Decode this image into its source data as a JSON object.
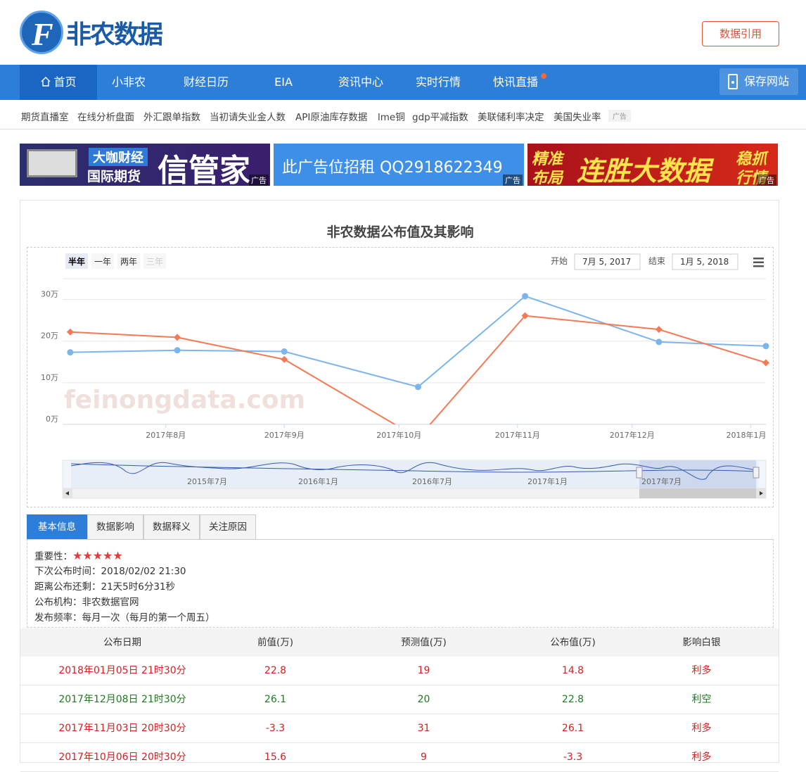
{
  "brand": {
    "name": "非农数据",
    "logo_letter": "F"
  },
  "header": {
    "cite_button": "数据引用"
  },
  "nav": {
    "items": [
      {
        "label": "首页",
        "active": true
      },
      {
        "label": "小非农"
      },
      {
        "label": "财经日历"
      },
      {
        "label": "EIA"
      },
      {
        "label": "资讯中心"
      },
      {
        "label": "实时行情"
      },
      {
        "label": "快讯直播",
        "dot": true
      }
    ],
    "save_button": "保存网站"
  },
  "quicklinks": {
    "items": [
      "期货直播室",
      "在线分析盘面",
      "外汇跟单指数",
      "当初请失业金人数",
      "API原油库存数据",
      "lme铜",
      "gdp平减指数",
      "美联储利率决定",
      "美国失业率"
    ],
    "ad_tag": "广告"
  },
  "ads": [
    {
      "text_top": "大咖财经",
      "text_bottom": "国际期货",
      "text_big": "信管家",
      "label": "广告"
    },
    {
      "text": "此广告位招租 QQ2918622349",
      "label": "广告"
    },
    {
      "text_left_top": "精准",
      "text_left_bottom": "布局",
      "text_big": "连胜大数据",
      "text_right_top": "稳抓",
      "text_right_bottom": "行情",
      "label": "广告"
    }
  ],
  "chart": {
    "title": "非农数据公布值及其影响",
    "range_buttons": [
      "半年",
      "一年",
      "两年",
      "三年"
    ],
    "active_range": "半年",
    "start_label": "开始",
    "start_value": "7月 5, 2017",
    "end_label": "结束",
    "end_value": "1月 5, 2018",
    "watermark": "feinongdata.com",
    "navigator_labels": [
      "2015年7月",
      "2016年1月",
      "2016年7月",
      "2017年1月",
      "2017年7月"
    ]
  },
  "chart_data": {
    "type": "line",
    "x": [
      "2017-07-07",
      "2017-08-04",
      "2017-09-01",
      "2017-10-06",
      "2017-11-03",
      "2017-12-08",
      "2018-01-05"
    ],
    "x_tick_labels": [
      "2017年8月",
      "2017年9月",
      "2017年10月",
      "2017年11月",
      "2017年12月",
      "2018年1月"
    ],
    "y_tick_labels": [
      "0万",
      "10万",
      "20万",
      "30万"
    ],
    "ylim": [
      0,
      30
    ],
    "grid": true,
    "colors": {
      "blue": "#7cb5ec",
      "orange": "#f47a55"
    },
    "series": [
      {
        "color": "#7cb5ec",
        "marker": "circle",
        "values": [
          17.3,
          17.8,
          17.5,
          9.0,
          30.8,
          19.8,
          18.8
        ]
      },
      {
        "color": "#f47a55",
        "marker": "diamond",
        "values": [
          22.2,
          20.9,
          15.6,
          -3.3,
          26.1,
          22.8,
          14.8
        ]
      }
    ]
  },
  "info": {
    "tabs": [
      "基本信息",
      "数据影响",
      "数据释义",
      "关注原因"
    ],
    "importance_label": "重要性：",
    "stars": 5,
    "next_release": "下次公布时间：2018/02/02 21:30",
    "countdown": "距离公布还剩：21天5时6分31秒",
    "agency": "公布机构：非农数据官网",
    "frequency": "发布频率：每月一次（每月的第一个周五）"
  },
  "table": {
    "headers": [
      "公布日期",
      "前值(万)",
      "预测值(万)",
      "公布值(万)",
      "影响白银"
    ],
    "rows": [
      {
        "date": "2018年01月05日 21时30分",
        "prev": "22.8",
        "forecast": "19",
        "actual": "14.8",
        "impact": "利多",
        "color": "red"
      },
      {
        "date": "2017年12月08日 21时30分",
        "prev": "26.1",
        "forecast": "20",
        "actual": "22.8",
        "impact": "利空",
        "color": "green"
      },
      {
        "date": "2017年11月03日 20时30分",
        "prev": "-3.3",
        "forecast": "31",
        "actual": "26.1",
        "impact": "利多",
        "color": "red"
      },
      {
        "date": "2017年10月06日 20时30分",
        "prev": "15.6",
        "forecast": "9",
        "actual": "-3.3",
        "impact": "利多",
        "color": "red"
      }
    ]
  }
}
